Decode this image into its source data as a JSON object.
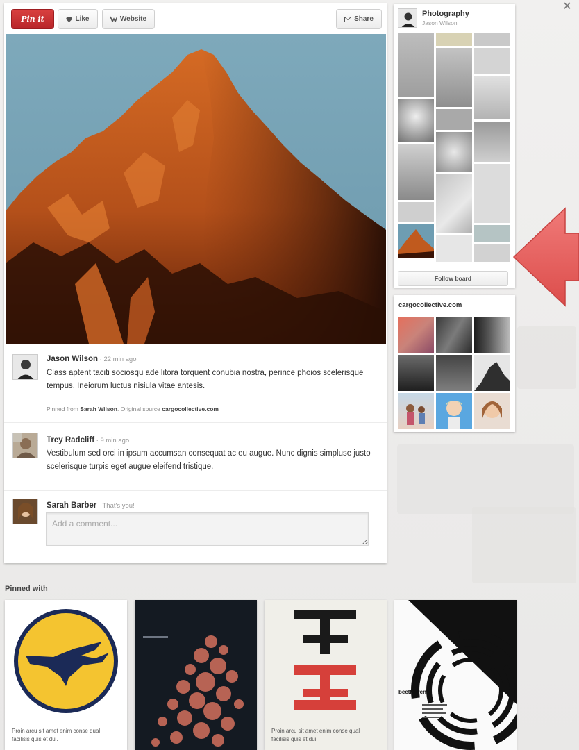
{
  "toolbar": {
    "pin_label": "Pin it",
    "like_label": "Like",
    "website_label": "Website",
    "share_label": "Share"
  },
  "comments": [
    {
      "name": "Jason Wilson",
      "time": " · 22 min ago",
      "text": "Class aptent taciti sociosqu ade litora torquent conubia nostra, perince phoios scelerisque tempus. Ineiorum luctus nisiula vitae antesis.",
      "source_prefix": "Pinned from ",
      "source_user": "Sarah Wilson",
      "source_mid": ". Original source ",
      "source_site": "cargocollective.com"
    },
    {
      "name": "Trey Radcliff",
      "time": " · 9 min ago",
      "text": "Vestibulum sed orci in ipsum accumsan consequat ac eu augue. Nunc dignis simpluse  justo scelerisque turpis eget augue eleifend tristique."
    },
    {
      "name": "Sarah Barber",
      "time": " · That's you!"
    }
  ],
  "comment_box": {
    "placeholder": "Add a comment..."
  },
  "board": {
    "title": "Photography",
    "owner": "Jason Wilson",
    "follow_label": "Follow board"
  },
  "source_board": {
    "title": "cargocollective.com"
  },
  "pinned_with": {
    "label": "Pinned with",
    "captions": [
      "Proin arcu sit amet enim conse qual facilisis quis et dui.",
      "Proin arcu sit amet enim conse qual facilisis quis et dui."
    ],
    "poster_text": "beethoven"
  },
  "icons": [
    "heart-icon",
    "website-icon",
    "share-icon",
    "close-icon"
  ],
  "colors": {
    "pin_red": "#c62c30",
    "arrow_red": "#e55a5a",
    "mountain_orange": "#c75a1c",
    "sky": "#6e9db2",
    "lufthansa_yellow": "#f4c430",
    "lufthansa_navy": "#1b2a57"
  }
}
